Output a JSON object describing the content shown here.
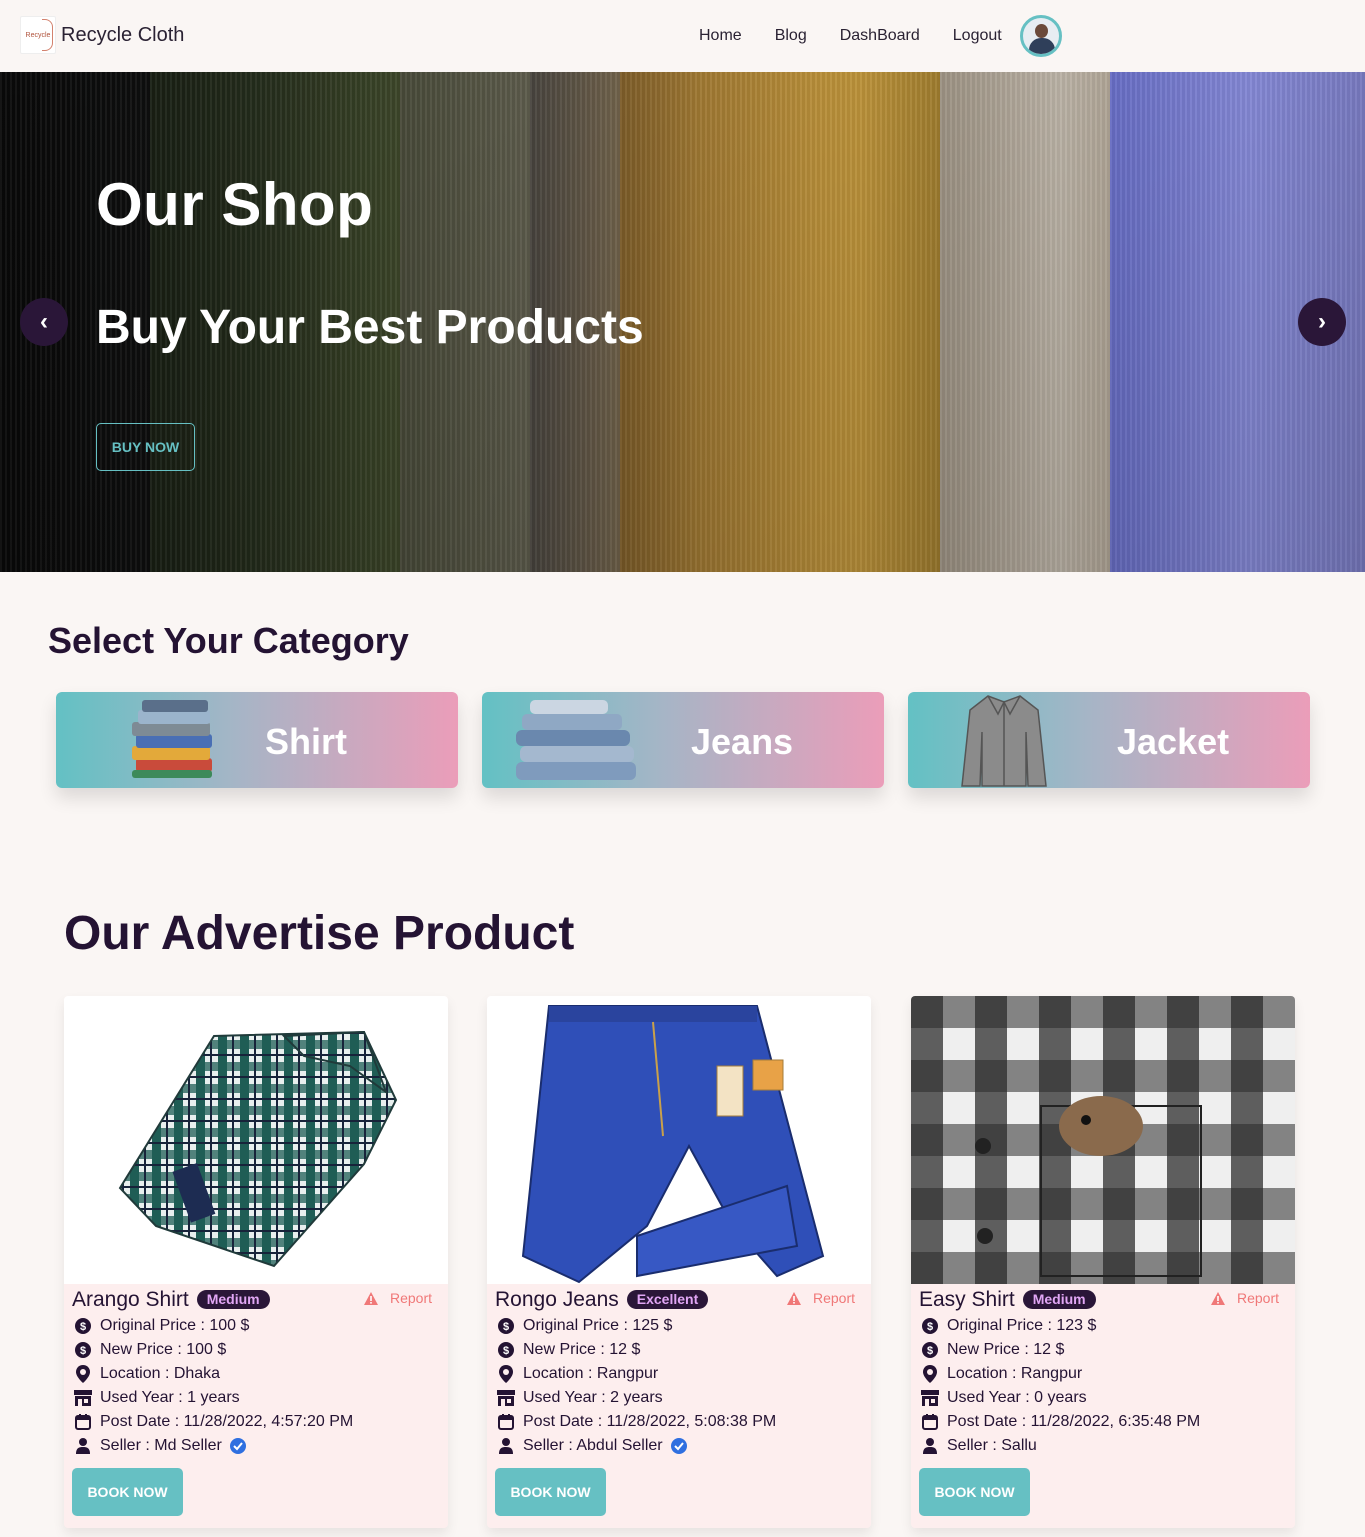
{
  "navbar": {
    "brand_logo_text": "Recycle",
    "brand_name": "Recycle Cloth",
    "links": [
      "Home",
      "Blog",
      "DashBoard",
      "Logout"
    ]
  },
  "hero": {
    "title": "Our Shop",
    "subtitle": "Buy Your Best Products",
    "button": "BUY NOW",
    "prev": "‹",
    "next": "›"
  },
  "category": {
    "title": "Select Your Category",
    "items": [
      "Shirt",
      "Jeans",
      "Jacket"
    ]
  },
  "advertise": {
    "title": "Our Advertise Product",
    "products": [
      {
        "name": "Arango Shirt",
        "condition": "Medium",
        "report": "Report",
        "original_price": "Original Price : 100 $",
        "new_price": "New Price : 100 $",
        "location": "Location : Dhaka",
        "used_year": "Used Year : 1 years",
        "post_date": "Post Date : 11/28/2022, 4:57:20 PM",
        "seller": "Seller : Md Seller",
        "verified": true,
        "button": "BOOK NOW"
      },
      {
        "name": "Rongo Jeans",
        "condition": "Excellent",
        "report": "Report",
        "original_price": "Original Price : 125 $",
        "new_price": "New Price : 12 $",
        "location": "Location : Rangpur",
        "used_year": "Used Year : 2 years",
        "post_date": "Post Date : 11/28/2022, 5:08:38 PM",
        "seller": "Seller : Abdul Seller",
        "verified": true,
        "button": "BOOK NOW"
      },
      {
        "name": "Easy Shirt",
        "condition": "Medium",
        "report": "Report",
        "original_price": "Original Price : 123 $",
        "new_price": "New Price : 12 $",
        "location": "Location : Rangpur",
        "used_year": "Used Year : 0 years",
        "post_date": "Post Date : 11/28/2022, 6:35:48 PM",
        "seller": "Seller : Sallu",
        "verified": false,
        "button": "BOOK NOW"
      }
    ]
  },
  "colors": {
    "accent": "#66c0c3",
    "dark": "#2a1638",
    "report": "#f07878",
    "verified": "#2f6fe0"
  }
}
